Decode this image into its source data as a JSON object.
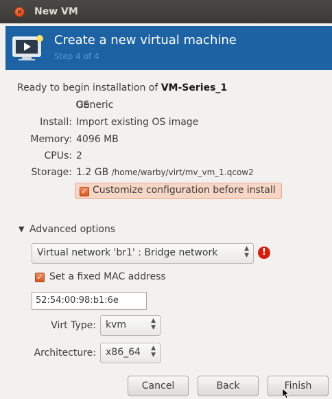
{
  "window": {
    "title": "New VM",
    "close_symbol": "×"
  },
  "header": {
    "title": "Create a new virtual machine",
    "step": "Step 4 of 4",
    "icon": "vm-monitor-icon"
  },
  "summary": {
    "ready_prefix": "Ready to begin installation of",
    "vm_name": "VM-Series_1",
    "rows": [
      {
        "label": "OS:",
        "value": "Generic"
      },
      {
        "label": "Install:",
        "value": "Import existing OS image"
      },
      {
        "label": "Memory:",
        "value": "4096 MB"
      },
      {
        "label": "CPUs:",
        "value": "2"
      },
      {
        "label": "Storage:",
        "value": "1.2 GB",
        "path": "/home/warby/virt/mv_vm_1.qcow2"
      }
    ]
  },
  "customize": {
    "label": "Customize configuration before install",
    "checked": true
  },
  "advanced": {
    "label": "Advanced options",
    "network": {
      "value": "Virtual network 'br1' : Bridge network",
      "warning": "!"
    },
    "fixed_mac": {
      "label": "Set a fixed MAC address",
      "checked": true
    },
    "mac_value": "52:54:00:98:b1:6e",
    "virt_type": {
      "label": "Virt Type:",
      "value": "kvm"
    },
    "architecture": {
      "label": "Architecture:",
      "value": "x86_64"
    }
  },
  "buttons": {
    "cancel": "Cancel",
    "back": "Back",
    "finish": "Finish"
  },
  "colors": {
    "header_bg": "#1d62a3",
    "accent": "#dd4814",
    "titlebar": "#3c3b37"
  }
}
